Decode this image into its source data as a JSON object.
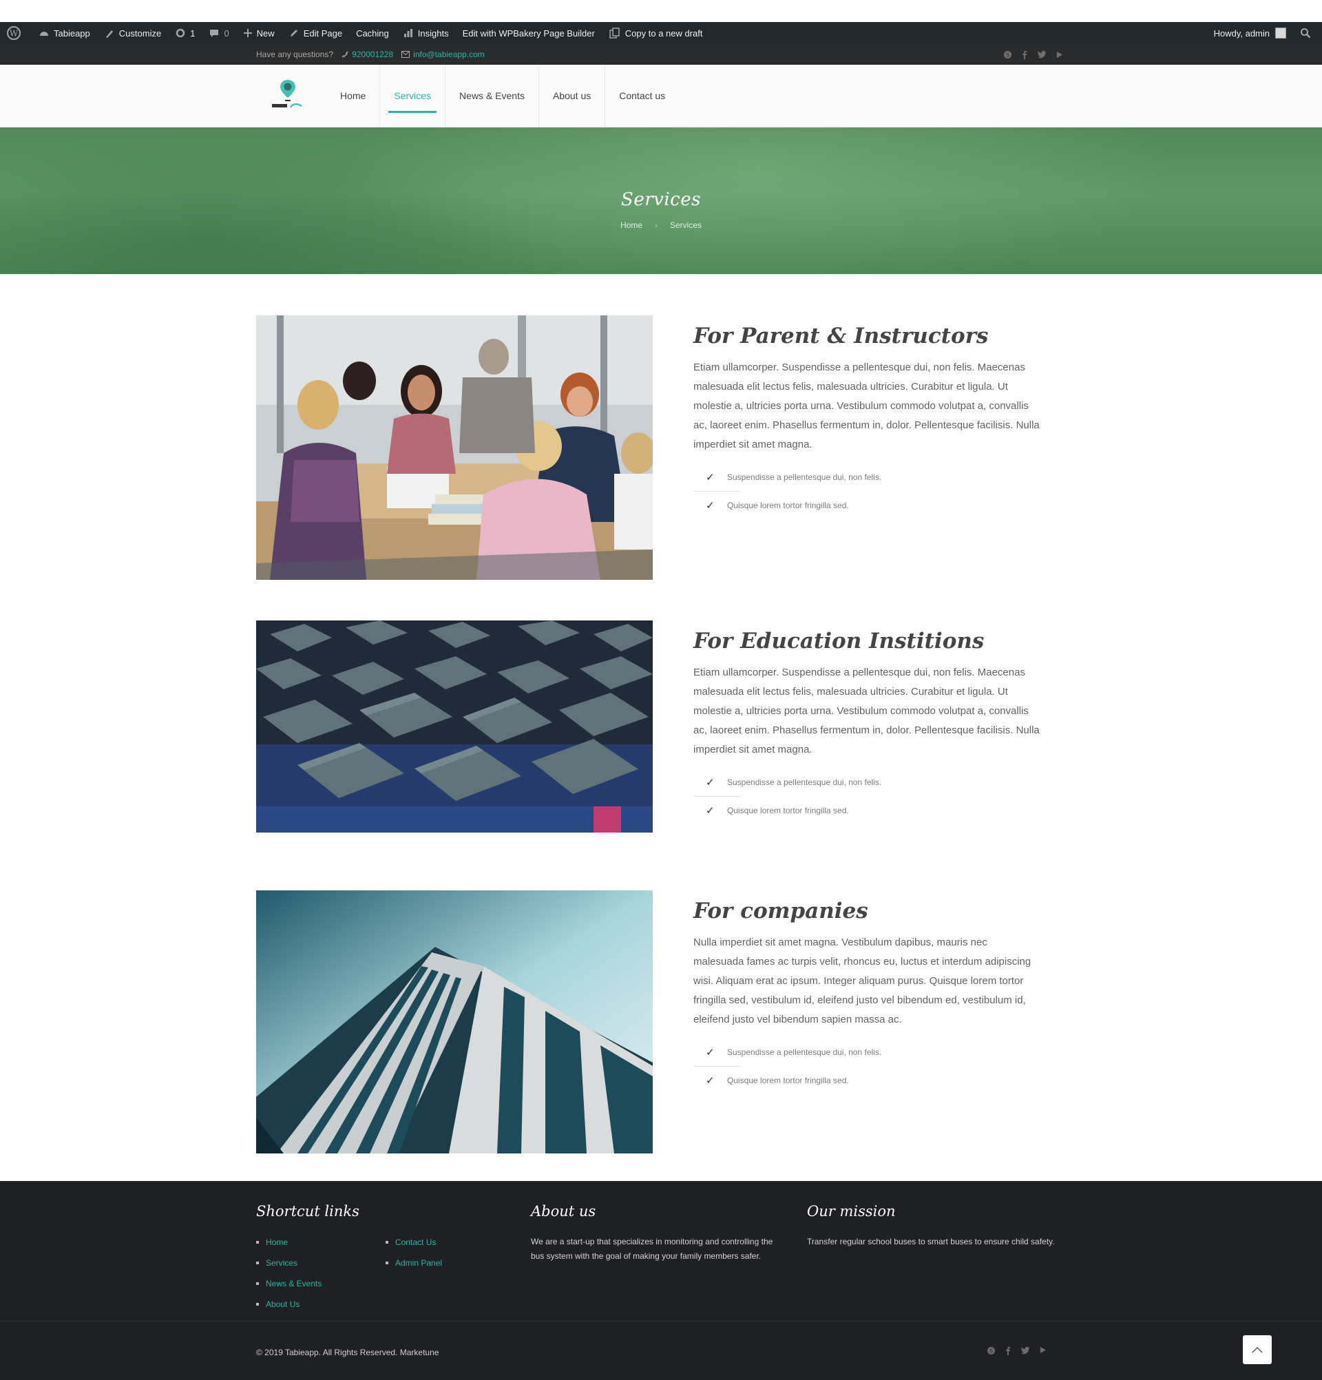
{
  "adminbar": {
    "site": "Tabieapp",
    "customize": "Customize",
    "updates": "1",
    "comments": "0",
    "new": "New",
    "edit_page": "Edit Page",
    "caching": "Caching",
    "insights": "Insights",
    "wpbakery": "Edit with WPBakery Page Builder",
    "copy_draft": "Copy to a new draft",
    "howdy": "Howdy, admin"
  },
  "infobar": {
    "question": "Have any questions?",
    "phone": "920001228",
    "email": "info@tabieapp.com",
    "social_icons": [
      "skype-icon",
      "facebook-icon",
      "twitter-icon",
      "youtube-icon"
    ]
  },
  "nav": {
    "items": [
      {
        "label": "Home"
      },
      {
        "label": "Services"
      },
      {
        "label": "News & Events"
      },
      {
        "label": "About us"
      },
      {
        "label": "Contact us"
      }
    ],
    "active": "Services"
  },
  "banner": {
    "title": "Services",
    "crumb_home": "Home",
    "crumb_current": "Services"
  },
  "services": [
    {
      "title": "For Parent & Instructors",
      "body": "Etiam ullamcorper. Suspendisse a pellentesque dui, non felis. Maecenas malesuada elit lectus felis, malesuada ultricies. Curabitur et ligula. Ut molestie a, ultricies porta urna. Vestibulum commodo volutpat a, convallis ac, laoreet enim. Phasellus fermentum in, dolor. Pellentesque facilisis. Nulla imperdiet sit amet magna.",
      "checks": [
        "Suspendisse a pellentesque dui, non felis.",
        "Quisque lorem tortor fringilla sed."
      ]
    },
    {
      "title": "For Education Institions",
      "body": "Etiam ullamcorper. Suspendisse a pellentesque dui, non felis. Maecenas malesuada elit lectus felis, malesuada ultricies. Curabitur et ligula. Ut molestie a, ultricies porta urna. Vestibulum commodo volutpat a, convallis ac, laoreet enim. Phasellus fermentum in, dolor. Pellentesque facilisis. Nulla imperdiet sit amet magna.",
      "checks": [
        "Suspendisse a pellentesque dui, non felis.",
        "Quisque lorem tortor fringilla sed."
      ]
    },
    {
      "title": "For companies",
      "body": "Nulla imperdiet sit amet magna. Vestibulum dapibus, mauris nec malesuada fames ac turpis velit, rhoncus eu, luctus et interdum adipiscing wisi. Aliquam erat ac ipsum. Integer aliquam purus. Quisque lorem tortor fringilla sed, vestibulum id, eleifend justo vel bibendum ed, vestibulum id, eleifend justo vel bibendum sapien massa ac.",
      "checks": [
        "Suspendisse a pellentesque dui, non felis.",
        "Quisque lorem tortor fringilla sed."
      ]
    }
  ],
  "footer": {
    "shortcut_title": "Shortcut links",
    "links_col1": [
      "Home",
      "Services",
      "News & Events",
      "About Us"
    ],
    "links_col2": [
      "Contact Us",
      "Admin Panel"
    ],
    "about_title": "About us",
    "about_text": "We are a start-up that specializes in monitoring and controlling the bus system with the goal of making your family members safer.",
    "mission_title": "Our mission",
    "mission_text": "Transfer regular school buses to smart buses to ensure child safety.",
    "copyright": "© 2019 Tabieapp. All Rights Reserved. Marketune"
  },
  "colors": {
    "accent": "#2bb5a8",
    "adminbar": "#23282d",
    "footer": "#1f2023"
  }
}
